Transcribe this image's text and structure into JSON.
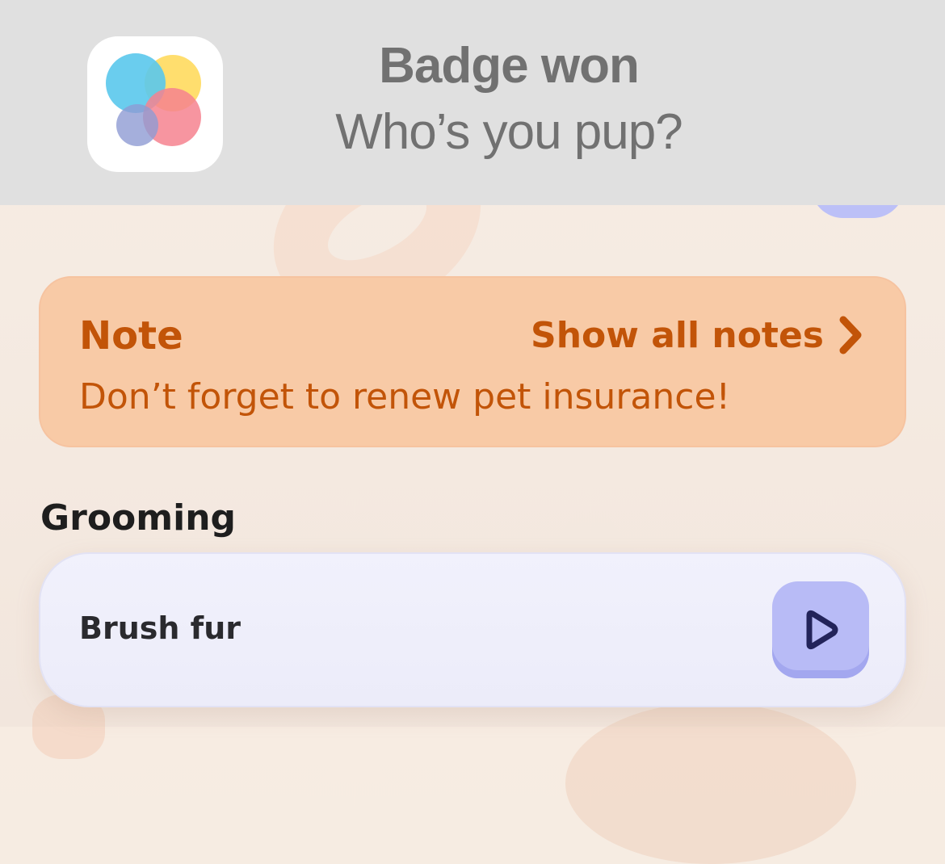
{
  "banner": {
    "title": "Badge won",
    "subtitle": "Who’s you pup?",
    "app_icon": "overlapping-circles-icon"
  },
  "note": {
    "title": "Note",
    "link_label": "Show all notes",
    "link_icon": "chevron-right-icon",
    "text": "Don’t forget to renew pet insurance!",
    "color": "#c25408",
    "background": "#f8caa6"
  },
  "grooming": {
    "section_title": "Grooming",
    "tasks": [
      {
        "label": "Brush fur",
        "action_icon": "play-icon"
      }
    ]
  },
  "colors": {
    "accent": "#b8bbf6",
    "play_icon": "#23245a",
    "banner_bg": "#e0e0e0"
  }
}
